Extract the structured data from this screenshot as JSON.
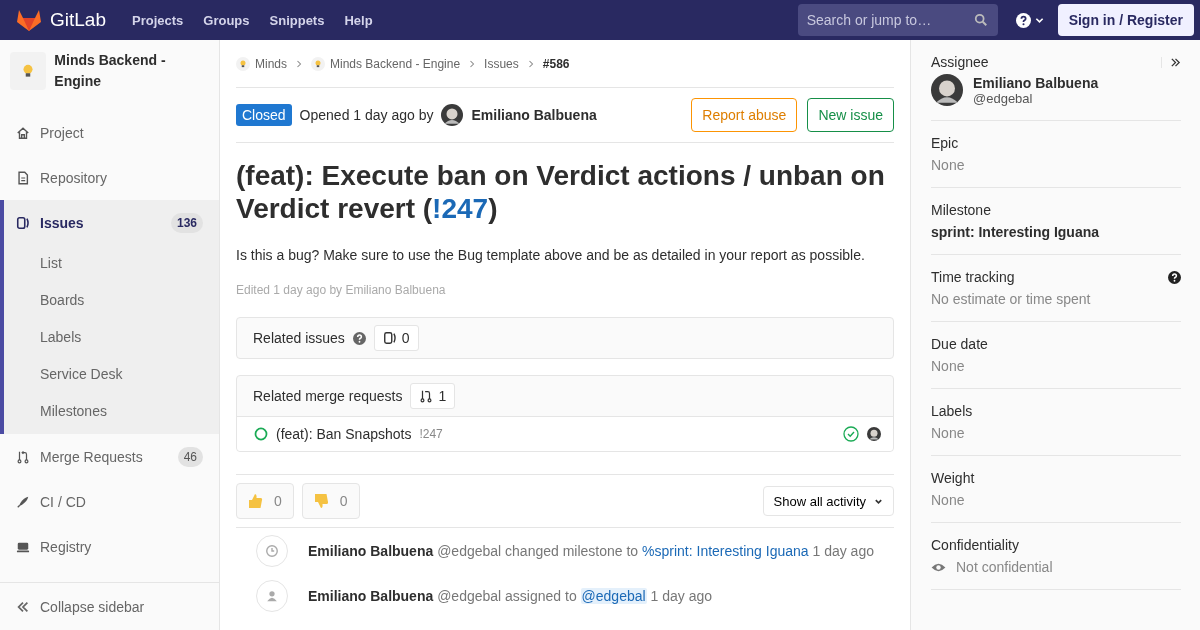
{
  "header": {
    "logo": "GitLab",
    "nav": [
      "Projects",
      "Groups",
      "Snippets",
      "Help"
    ],
    "search": {
      "placeholder": "Search or jump to…"
    },
    "sign_in": "Sign in / Register"
  },
  "sidebar": {
    "project": "Minds Backend - Engine",
    "items": [
      {
        "label": "Project",
        "selected": false
      },
      {
        "label": "Repository",
        "selected": false
      },
      {
        "label": "Issues",
        "count": "136",
        "selected": true,
        "children": [
          {
            "label": "List"
          },
          {
            "label": "Boards"
          },
          {
            "label": "Labels"
          },
          {
            "label": "Service Desk"
          },
          {
            "label": "Milestones"
          }
        ]
      },
      {
        "label": "Merge Requests",
        "count": "46",
        "selected": false
      },
      {
        "label": "CI / CD",
        "selected": false
      },
      {
        "label": "Registry",
        "selected": false
      }
    ],
    "collapse": "Collapse sidebar"
  },
  "breadcrumbs": [
    {
      "label": "Minds",
      "avatar": true
    },
    {
      "label": "Minds Backend - Engine",
      "avatar": true
    },
    {
      "label": "Issues",
      "avatar": false
    },
    {
      "label": "#586",
      "avatar": false
    }
  ],
  "issue": {
    "status": "Closed",
    "opened": "Opened 1 day ago by",
    "author": "Emiliano Balbuena",
    "buttons": [
      {
        "label": "Report abuse",
        "kind": "warning"
      },
      {
        "label": "New issue",
        "kind": "success"
      }
    ],
    "title_before": "(feat): Execute ban on Verdict actions / unban on Verdict revert (",
    "title_link": "!247",
    "title_after": ")",
    "description": "Is this a bug? Make sure to use the Bug template above and be as detailed in your report as possible.",
    "edited": "Edited 1 day ago by Emiliano Balbuena"
  },
  "related_issues": {
    "label": "Related issues",
    "count": "0"
  },
  "related_merge_requests": {
    "label": "Related merge requests",
    "count": "1",
    "items": [
      {
        "title": "(feat): Ban Snapshots",
        "ref": "!247"
      }
    ]
  },
  "reactions": [
    {
      "kind": "thumbsup",
      "count": "0"
    },
    {
      "kind": "thumbsdown",
      "count": "0"
    }
  ],
  "activity_filter": "Show all activity",
  "notes": [
    {
      "kind": "milestone",
      "author": "Emiliano Balbuena",
      "handle": "@edgebal",
      "action": "changed milestone to",
      "link": "%sprint: Interesting Iguana",
      "mention": false,
      "time": "1 day ago"
    },
    {
      "kind": "assign",
      "author": "Emiliano Balbuena",
      "handle": "@edgebal",
      "action": "assigned to",
      "link": "@edgebal",
      "mention": true,
      "time": "1 day ago"
    }
  ],
  "right_sidebar": {
    "assignee": {
      "label": "Assignee",
      "name": "Emiliano Balbuena",
      "handle": "@edgebal"
    },
    "fields": [
      {
        "label": "Epic",
        "value": "None",
        "kind": "plain"
      },
      {
        "label": "Milestone",
        "value": "sprint: Interesting Iguana",
        "kind": "strong"
      },
      {
        "label": "Time tracking",
        "value": "No estimate or time spent",
        "kind": "help"
      },
      {
        "label": "Due date",
        "value": "None",
        "kind": "plain"
      },
      {
        "label": "Labels",
        "value": "None",
        "kind": "plain"
      },
      {
        "label": "Weight",
        "value": "None",
        "kind": "plain"
      },
      {
        "label": "Confidentiality",
        "value": "Not confidential",
        "kind": "confidential"
      }
    ]
  }
}
